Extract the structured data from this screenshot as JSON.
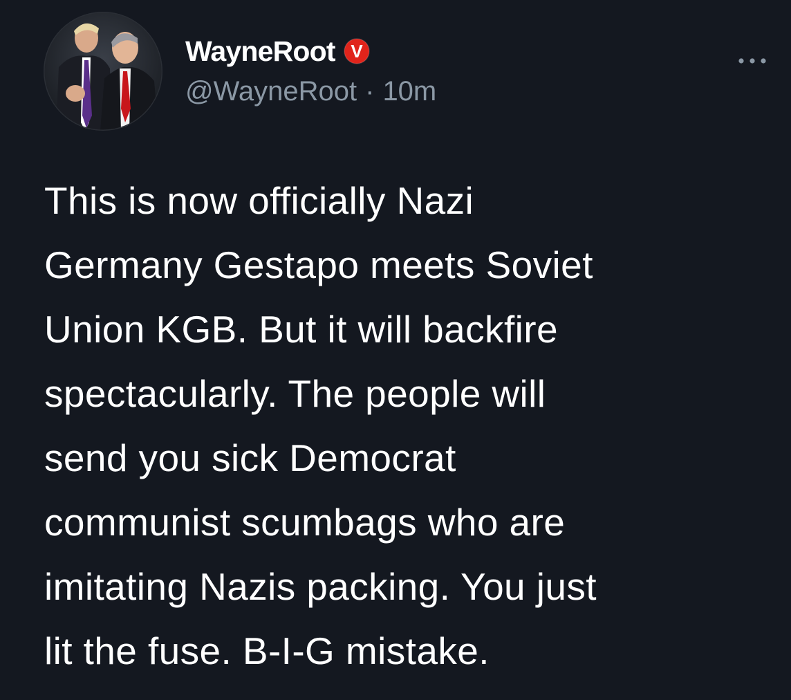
{
  "tweet": {
    "author": {
      "display_name": "WayneRoot",
      "verified_badge_letter": "V",
      "verified_badge_icon": "red-verified-v-badge",
      "handle": "@WayneRoot",
      "separator": "·",
      "timestamp": "10m",
      "avatar_icon": "profile-photo-two-men-in-suits"
    },
    "more_icon": "ellipsis-icon",
    "text_lines": [
      "This is now officially Nazi",
      "Germany Gestapo meets Soviet",
      "Union KGB. But it will backfire",
      "spectacularly. The people will",
      "send you sick Democrat",
      "communist scumbags who are",
      "imitating Nazis packing. You just",
      "lit the fuse. B-I-G mistake."
    ]
  },
  "colors": {
    "background": "#141820",
    "text": "#ffffff",
    "secondary_text": "#8b98a5",
    "badge": "#e0241b"
  }
}
